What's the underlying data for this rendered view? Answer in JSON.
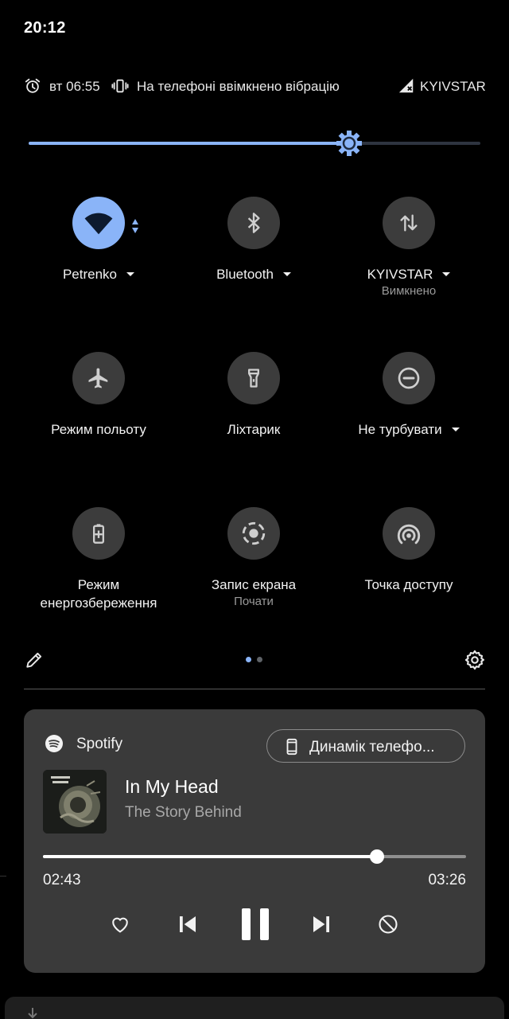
{
  "status_bar": {
    "time": "20:12"
  },
  "info_row": {
    "alarm_time": "вт 06:55",
    "vibration_text": "На телефоні ввімкнено вібрацію",
    "carrier": "KYIVSTAR"
  },
  "brightness": {
    "level": 0.71
  },
  "tiles": [
    {
      "label": "Petrenko",
      "sub": "",
      "icon": "wifi-icon",
      "active": true
    },
    {
      "label": "Bluetooth",
      "sub": "",
      "icon": "bluetooth-icon",
      "active": false
    },
    {
      "label": "KYIVSTAR",
      "sub": "Вимкнено",
      "icon": "mobile-data-icon",
      "active": false
    },
    {
      "label": "Режим польоту",
      "sub": "",
      "icon": "airplane-icon",
      "active": false
    },
    {
      "label": "Ліхтарик",
      "sub": "",
      "icon": "flashlight-icon",
      "active": false
    },
    {
      "label": "Не турбувати",
      "sub": "",
      "icon": "do-not-disturb-icon",
      "active": false
    },
    {
      "label": "Режим енергозбереження",
      "sub": "",
      "icon": "battery-saver-icon",
      "active": false
    },
    {
      "label": "Запис екрана",
      "sub": "Почати",
      "icon": "screen-record-icon",
      "active": false
    },
    {
      "label": "Точка доступу",
      "sub": "",
      "icon": "hotspot-icon",
      "active": false
    }
  ],
  "pager": {
    "pages": 2,
    "current": 1
  },
  "media": {
    "app_name": "Spotify",
    "output_device": "Динамік телефо...",
    "song_title": "In My Head",
    "artist": "The Story Behind",
    "elapsed": "02:43",
    "duration": "03:26",
    "progress": 0.79
  },
  "colors": {
    "accent": "#8ab4f8",
    "tile_bg": "#3c3c3c",
    "card_bg": "#3a3a3a"
  }
}
